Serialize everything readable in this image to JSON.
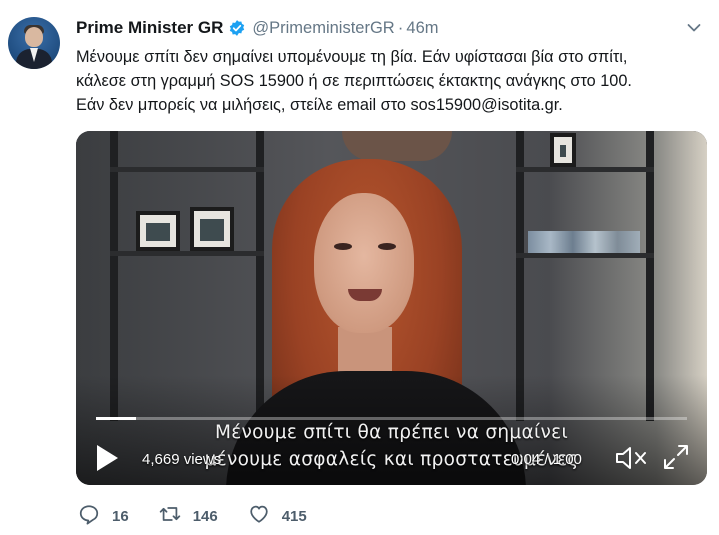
{
  "tweet": {
    "display_name": "Prime Minister GR",
    "handle": "@PrimeministerGR",
    "separator": "·",
    "time": "46m",
    "text_lines": [
      "Μένουμε σπίτι δεν σημαίνει υπομένουμε τη βία. Εάν υφίστασαι βία στο σπίτι,",
      "κάλεσε στη γραμμή SOS 15900 ή σε περιπτώσεις έκτακτης ανάγκης στο 100.",
      "Εάν δεν μπορείς να μιλήσεις, στείλε email στο sos15900@isotita.gr."
    ]
  },
  "video": {
    "subtitle_line1": "Μένουμε σπίτι θα πρέπει να σημαίνει",
    "subtitle_line2": "μένουμε ασφαλείς και προστατευμένες",
    "views": "4,669 views",
    "timecode": "0:04 / 1:00",
    "progress_fraction": 0.067
  },
  "actions": {
    "replies": "16",
    "retweets": "146",
    "likes": "415"
  },
  "icons": {
    "verified": "verified-badge-icon",
    "caret": "chevron-down-icon",
    "play": "play-icon",
    "mute": "muted-speaker-icon",
    "fullscreen": "fullscreen-icon",
    "reply": "reply-icon",
    "retweet": "retweet-icon",
    "like": "heart-icon"
  },
  "colors": {
    "verified": "#1da1f2",
    "secondary_text": "#657786",
    "action_icon": "#4d5d6b"
  }
}
